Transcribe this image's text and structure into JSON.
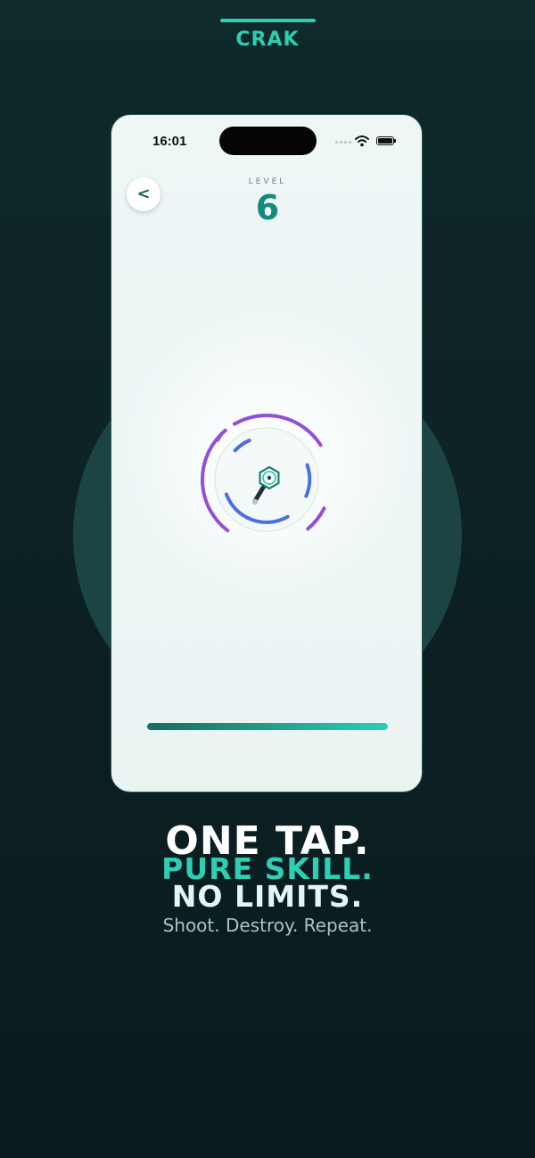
{
  "brand": {
    "name": "CRAK"
  },
  "phone": {
    "status_bar": {
      "time": "16:01"
    },
    "back_button": {
      "label": "<"
    },
    "level": {
      "label": "LEVEL",
      "value": "6"
    },
    "progress": {
      "fraction": 1.0
    }
  },
  "headline": {
    "line1": "ONE TAP.",
    "line2": "PURE SKILL.",
    "line3": "NO LIMITS."
  },
  "tagline": "Shoot. Destroy. Repeat.",
  "colors": {
    "accent": "#2ccfb4",
    "outer_ring": "#8d4fe0",
    "inner_ring": "#4a6fe0",
    "level_number": "#168a7e"
  }
}
